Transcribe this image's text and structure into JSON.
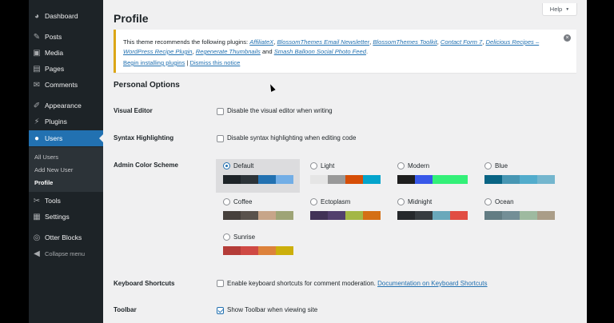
{
  "sidebar": {
    "items": [
      {
        "label": "Dashboard",
        "icon": "dashboard-icon",
        "glyph": "◕"
      },
      {
        "label": "Posts",
        "icon": "pin-icon",
        "glyph": "✎"
      },
      {
        "label": "Media",
        "icon": "media-icon",
        "glyph": "▣"
      },
      {
        "label": "Pages",
        "icon": "pages-icon",
        "glyph": "▤"
      },
      {
        "label": "Comments",
        "icon": "comments-icon",
        "glyph": "✉"
      },
      {
        "label": "Appearance",
        "icon": "brush-icon",
        "glyph": "✐"
      },
      {
        "label": "Plugins",
        "icon": "plug-icon",
        "glyph": "⚡"
      },
      {
        "label": "Users",
        "icon": "user-icon",
        "glyph": "●"
      },
      {
        "label": "Tools",
        "icon": "wrench-icon",
        "glyph": "✂"
      },
      {
        "label": "Settings",
        "icon": "settings-icon",
        "glyph": "▦"
      },
      {
        "label": "Otter Blocks",
        "icon": "otter-icon",
        "glyph": "◎"
      },
      {
        "label": "Collapse menu",
        "icon": "collapse-icon",
        "glyph": "◀"
      }
    ],
    "submenu": [
      "All Users",
      "Add New User",
      "Profile"
    ]
  },
  "page": {
    "title": "Profile",
    "help": "Help",
    "help_arrow": "▼"
  },
  "notice": {
    "prefix": "This theme recommends the following plugins: ",
    "plugins": [
      "AffiliateX",
      "BlossomThemes Email Newsletter",
      "BlossomThemes Toolkit",
      "Contact Form 7",
      "Delicious Recipes – WordPress Recipe Plugin",
      "Regenerate Thumbnails",
      "Smash Balloon Social Photo Feed"
    ],
    "and": " and ",
    "begin": "Begin installing plugins",
    "separator": " | ",
    "dismiss": "Dismiss this notice",
    "close": "×"
  },
  "personal_options": {
    "section_title": "Personal Options",
    "visual_editor": {
      "label": "Visual Editor",
      "text": "Disable the visual editor when writing",
      "checked": false
    },
    "syntax": {
      "label": "Syntax Highlighting",
      "text": "Disable syntax highlighting when editing code",
      "checked": false
    },
    "color_scheme_label": "Admin Color Scheme",
    "schemes": [
      {
        "name": "Default",
        "selected": true,
        "colors": [
          "#1d2327",
          "#2c3338",
          "#2271b1",
          "#72aee6"
        ]
      },
      {
        "name": "Light",
        "selected": false,
        "colors": [
          "#e5e5e5",
          "#999999",
          "#d64e07",
          "#04a4cc"
        ]
      },
      {
        "name": "Modern",
        "selected": false,
        "colors": [
          "#1e1e1e",
          "#3858e9",
          "#33f078",
          "#33f078"
        ]
      },
      {
        "name": "Blue",
        "selected": false,
        "colors": [
          "#096484",
          "#4796b3",
          "#52accc",
          "#74b6ce"
        ]
      },
      {
        "name": "Coffee",
        "selected": false,
        "colors": [
          "#46403c",
          "#59524c",
          "#c7a589",
          "#9ea476"
        ]
      },
      {
        "name": "Ectoplasm",
        "selected": false,
        "colors": [
          "#413256",
          "#523f6d",
          "#a3b745",
          "#d46f15"
        ]
      },
      {
        "name": "Midnight",
        "selected": false,
        "colors": [
          "#25282b",
          "#363b3f",
          "#69a8bb",
          "#e14d43"
        ]
      },
      {
        "name": "Ocean",
        "selected": false,
        "colors": [
          "#627c83",
          "#738e96",
          "#9ebaa0",
          "#aa9d88"
        ]
      },
      {
        "name": "Sunrise",
        "selected": false,
        "colors": [
          "#b43c38",
          "#cf4944",
          "#dd823b",
          "#ccaf0b"
        ]
      }
    ],
    "keyboard": {
      "label": "Keyboard Shortcuts",
      "text": "Enable keyboard shortcuts for comment moderation.",
      "link": "Documentation on Keyboard Shortcuts",
      "checked": false
    },
    "toolbar": {
      "label": "Toolbar",
      "text": "Show Toolbar when viewing site",
      "checked": true
    }
  }
}
